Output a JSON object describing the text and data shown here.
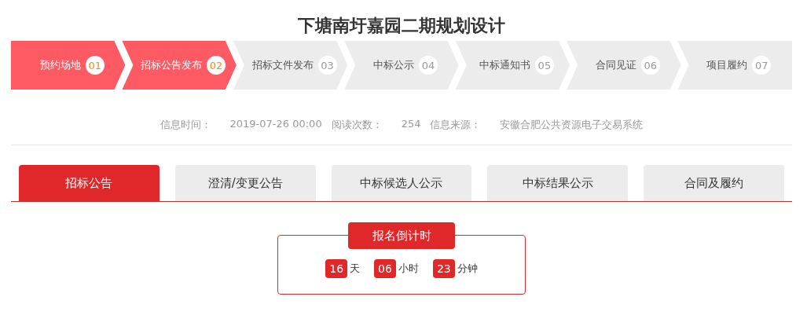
{
  "title": "下塘南圩嘉园二期规划设计",
  "steps": [
    {
      "label": "预约场地",
      "number": "01",
      "done": true
    },
    {
      "label": "招标公告发布",
      "number": "02",
      "done": true
    },
    {
      "label": "招标文件发布",
      "number": "03",
      "done": false
    },
    {
      "label": "中标公示",
      "number": "04",
      "done": false
    },
    {
      "label": "中标通知书",
      "number": "05",
      "done": false
    },
    {
      "label": "合同见证",
      "number": "06",
      "done": false
    },
    {
      "label": "项目履约",
      "number": "07",
      "done": false
    }
  ],
  "meta": [
    {
      "label": "信息时间：",
      "value": "2019-07-26 00:00"
    },
    {
      "label": "阅读次数：",
      "value": "254"
    },
    {
      "label": "信息来源：",
      "value": "安徽合肥公共资源电子交易系统"
    }
  ],
  "tabs": [
    {
      "label": "招标公告",
      "selected": true
    },
    {
      "label": "澄清/变更公告",
      "selected": false
    },
    {
      "label": "中标候选人公示",
      "selected": false
    },
    {
      "label": "中标结果公示",
      "selected": false
    },
    {
      "label": "合同及履约",
      "selected": false
    }
  ],
  "countdown": {
    "title": "报名倒计时",
    "units": [
      {
        "value": "16",
        "unit": "天"
      },
      {
        "value": "06",
        "unit": "小时"
      },
      {
        "value": "23",
        "unit": "分钟"
      }
    ]
  }
}
